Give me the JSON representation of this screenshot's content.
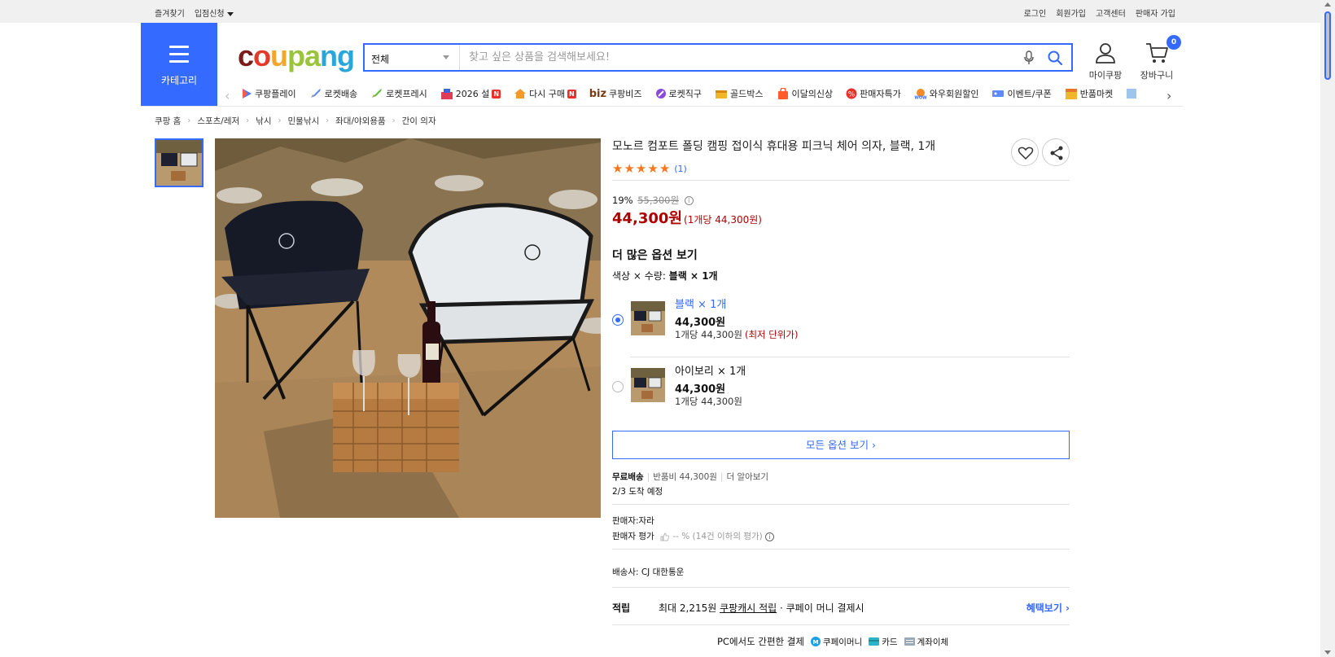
{
  "topbar": {
    "favorites": "즐겨찾기",
    "vendor_apply": "입점신청",
    "login": "로그인",
    "signup": "회원가입",
    "customer_center": "고객센터",
    "seller_signup": "판매자 가입"
  },
  "header": {
    "category_label": "카테고리",
    "logo": {
      "c1": "c",
      "c2": "o",
      "c3": "u",
      "c4": "pa",
      "c5": "ng"
    },
    "search_scope": "전체",
    "search_placeholder": "찾고 싶은 상품을 검색해보세요!",
    "mypage_label": "마이쿠팡",
    "cart_label": "장바구니",
    "cart_count": "0"
  },
  "catnav": {
    "items": [
      {
        "label": "쿠팡플레이"
      },
      {
        "label": "로켓배송"
      },
      {
        "label": "로켓프레시"
      },
      {
        "label": "2026 설",
        "badge": "N"
      },
      {
        "label": "다시 구매",
        "badge": "N"
      },
      {
        "label": "쿠팡비즈",
        "prefix": "biz"
      },
      {
        "label": "로켓직구"
      },
      {
        "label": "골드박스"
      },
      {
        "label": "이달의신상"
      },
      {
        "label": "판매자특가"
      },
      {
        "label": "와우회원할인"
      },
      {
        "label": "이벤트/쿠폰"
      },
      {
        "label": "반품마켓"
      }
    ]
  },
  "breadcrumb": [
    "쿠팡 홈",
    "스포츠/레저",
    "낚시",
    "민물낚시",
    "좌대/야외용품",
    "간이 의자"
  ],
  "product": {
    "title": "모노르 컴포트 폴딩 캠핑 접이식 휴대용 피크닉 체어 의자, 블랙, 1개",
    "review_count": "(1)",
    "rating": 5,
    "discount": "19%",
    "original_price": "55,300원",
    "price": "44,300원",
    "unit_price": "(1개당 44,300원)",
    "more_options": "더 많은 옵션 보기",
    "option_label": "색상 × 수량:",
    "option_value": "블랙 × 1개",
    "options": [
      {
        "name": "블랙 × 1개",
        "price": "44,300원",
        "unit": "1개당 44,300원",
        "lowest": "(최저 단위가)",
        "selected": true
      },
      {
        "name": "아이보리 × 1개",
        "price": "44,300원",
        "unit": "1개당 44,300원",
        "lowest": "",
        "selected": false
      }
    ],
    "all_options_btn": "모든 옵션 보기",
    "shipping": {
      "free": "무료배송",
      "return_fee": "반품비 44,300원",
      "learn_more": "더 알아보기",
      "arrival": "2/3 도착 예정"
    },
    "seller": "판매자:자라",
    "seller_rating_label": "판매자 평가",
    "seller_rating_value": "-- % (14건 이하의 평가)",
    "carrier": "배송사:  CJ 대한통운",
    "earn": {
      "label": "적립",
      "prefix": "최대 2,215원",
      "link": "쿠팡캐시 적립",
      "suffix": "· 쿠페이 머니 결제시",
      "more": "혜택보기"
    },
    "payment": {
      "title": "PC에서도 간편한 결제",
      "methods": [
        "쿠페이머니",
        "카드",
        "계좌이체"
      ]
    }
  }
}
